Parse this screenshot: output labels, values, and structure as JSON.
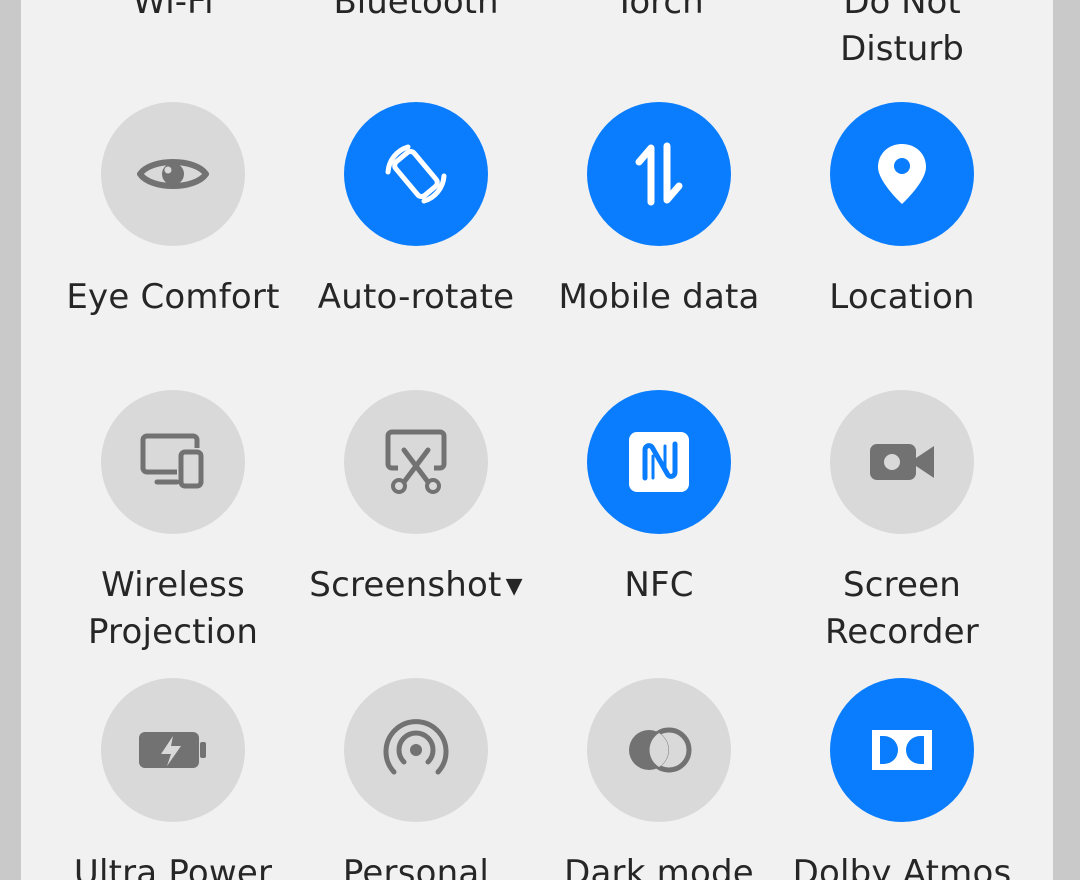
{
  "top_row_labels": [
    "Wi-Fi",
    "Bluetooth",
    "Torch",
    "Do Not\nDisturb"
  ],
  "tiles": [
    {
      "label": "Eye Comfort",
      "state": "off",
      "icon": "eye-icon"
    },
    {
      "label": "Auto-rotate",
      "state": "on",
      "icon": "auto-rotate-icon"
    },
    {
      "label": "Mobile data",
      "state": "on",
      "icon": "mobile-data-icon"
    },
    {
      "label": "Location",
      "state": "on",
      "icon": "location-pin-icon"
    },
    {
      "label": "Wireless\nProjection",
      "state": "off",
      "icon": "wireless-projection-icon"
    },
    {
      "label": "Screenshot",
      "state": "off",
      "icon": "screenshot-scissors-icon",
      "dropdown": "▼"
    },
    {
      "label": "NFC",
      "state": "on",
      "icon": "nfc-icon"
    },
    {
      "label": "Screen\nRecorder",
      "state": "off",
      "icon": "screen-recorder-icon"
    },
    {
      "label": "Ultra Power",
      "state": "off",
      "icon": "battery-bolt-icon"
    },
    {
      "label": "Personal",
      "state": "off",
      "icon": "hotspot-icon"
    },
    {
      "label": "Dark mode",
      "state": "off",
      "icon": "dark-mode-icon"
    },
    {
      "label": "Dolby Atmos",
      "state": "on",
      "icon": "dolby-icon"
    }
  ],
  "colors": {
    "active": "#0a7dff",
    "inactive": "#d9d9d9",
    "inactive_icon": "#727272",
    "label": "#262626",
    "panel": "#f1f1f1"
  }
}
